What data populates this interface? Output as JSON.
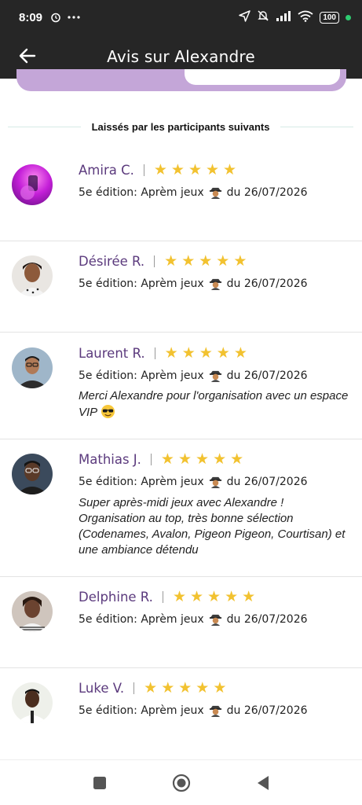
{
  "status_bar": {
    "time": "8:09",
    "battery": "100",
    "icons": [
      "alarm-icon",
      "more-icon",
      "location-icon",
      "mute-icon",
      "signal-icon",
      "wifi-icon",
      "battery-icon"
    ]
  },
  "header": {
    "title": "Avis sur Alexandre",
    "back_icon": "arrow-left-icon"
  },
  "colors": {
    "bar_bg": "#262626",
    "accent_purple": "#5b3a7d",
    "tab_purple": "#c4a6d8",
    "star": "#f2c230"
  },
  "section": {
    "heading": "Laissés par les participants suivants"
  },
  "reviews": [
    {
      "name": "Amira C.",
      "rating": 5,
      "edition": "5e édition: Aprèm jeux",
      "date": "du 26/07/2026",
      "comment": ""
    },
    {
      "name": "Désirée R.",
      "rating": 5,
      "edition": "5e édition: Aprèm jeux",
      "date": "du 26/07/2026",
      "comment": ""
    },
    {
      "name": "Laurent R.",
      "rating": 5,
      "edition": "5e édition: Aprèm jeux",
      "date": "du 26/07/2026",
      "comment": "Merci Alexandre pour l'organisation avec un espace VIP"
    },
    {
      "name": "Mathias J.",
      "rating": 5,
      "edition": "5e édition: Aprèm jeux",
      "date": "du 26/07/2026",
      "comment": "Super après-midi jeux avec Alexandre ! Organisation au top, très bonne sélection (Codenames, Avalon, Pigeon Pigeon, Courtisan) et une ambiance détendu"
    },
    {
      "name": "Delphine R.",
      "rating": 5,
      "edition": "5e édition: Aprèm jeux",
      "date": "du 26/07/2026",
      "comment": ""
    },
    {
      "name": "Luke V.",
      "rating": 5,
      "edition": "5e édition: Aprèm jeux",
      "date": "du 26/07/2026",
      "comment": ""
    }
  ],
  "nav": {
    "items": [
      "recents-square-icon",
      "home-circle-icon",
      "back-triangle-icon"
    ]
  }
}
